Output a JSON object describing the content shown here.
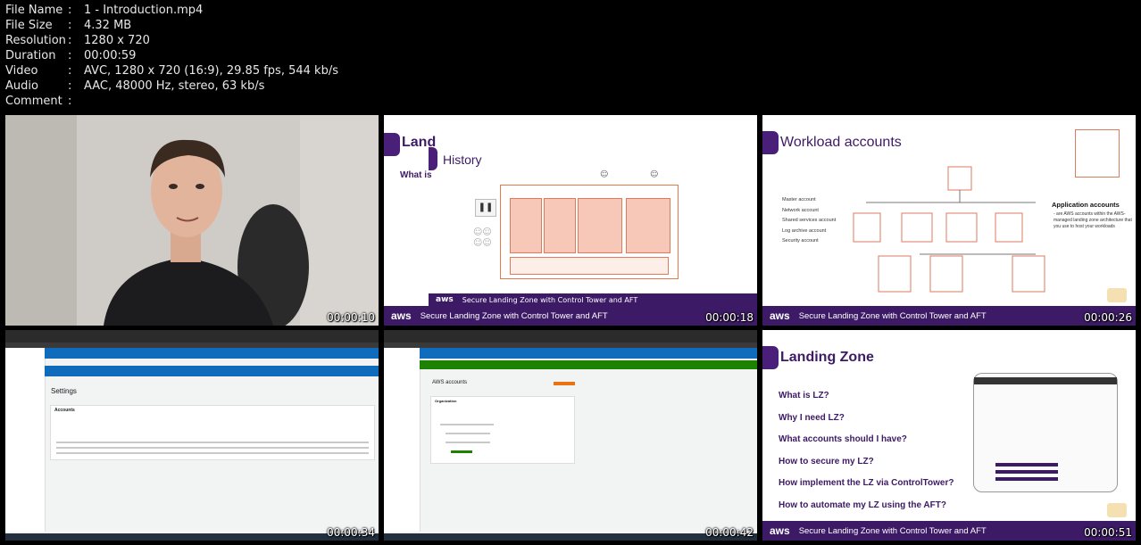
{
  "metadata": [
    {
      "key": "File Name",
      "value": "1 - Introduction.mp4"
    },
    {
      "key": "File Size",
      "value": "4.32 MB"
    },
    {
      "key": "Resolution",
      "value": "1280 x 720"
    },
    {
      "key": "Duration",
      "value": "00:00:59"
    },
    {
      "key": "Video",
      "value": "AVC, 1280 x 720 (16:9), 29.85 fps, 544 kb/s"
    },
    {
      "key": "Audio",
      "value": "AAC, 48000 Hz, stereo, 63 kb/s"
    },
    {
      "key": "Comment",
      "value": ""
    }
  ],
  "separator": ":",
  "banner": {
    "logo": "aws",
    "title": "Secure Landing Zone with Control Tower and AFT"
  },
  "thumbs": [
    {
      "timestamp": "00:00:10"
    },
    {
      "timestamp": "00:00:18",
      "title_back": "Land",
      "subtitle_back": "What is",
      "title_front": "History"
    },
    {
      "timestamp": "00:00:26",
      "title": "Workload accounts",
      "accounts": [
        "Master account",
        "Network account",
        "Shared services account",
        "Log archive account",
        "Security account"
      ],
      "app_title": "Application accounts",
      "app_desc": "- are AWS accounts within the AWS-managed landing zone architecture that you use to host your workloads"
    },
    {
      "timestamp": "00:00:34",
      "page_title": "Settings",
      "section": "Accounts"
    },
    {
      "timestamp": "00:00:42",
      "page_title": "AWS accounts",
      "section": "Organization"
    },
    {
      "timestamp": "00:00:51",
      "title": "Landing Zone",
      "questions": [
        "What is LZ?",
        "Why I need LZ?",
        "What accounts should I have?",
        "How to secure my LZ?",
        "How implement the LZ via ControlTower?",
        "How to automate my LZ using the AFT?"
      ]
    }
  ],
  "colors": {
    "brand": "#3d1a66",
    "accent": "#e8774a",
    "aws_orange": "#ff9900"
  }
}
